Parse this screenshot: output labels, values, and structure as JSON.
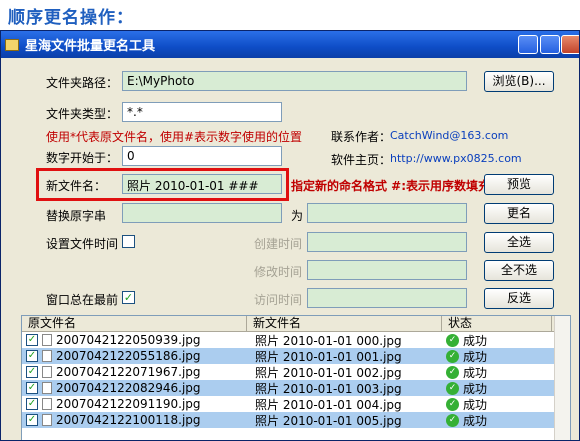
{
  "heading": "顺序更名操作：",
  "window": {
    "title": "星海文件批量更名工具"
  },
  "form": {
    "folder_path_label": "文件夹路径：",
    "folder_path_value": "E:\\MyPhoto",
    "browse_button": "浏览(B)...",
    "folder_type_label": "文件夹类型：",
    "folder_type_value": "*.*",
    "hint": "使用*代表原文件名，使用#表示数字使用的位置",
    "contact_label": "联系作者：",
    "contact_value": "CatchWind@163.com",
    "start_label": "数字开始于：",
    "start_value": "0",
    "homepage_label": "软件主页：",
    "homepage_value": "http://www.px0825.com",
    "newname_label": "新文件名：",
    "newname_value": "照片 2010-01-01 ###",
    "annotation": "指定新的命名格式 #:表示用序数填充",
    "preview_button": "预览",
    "replace_label": "替换原字串",
    "replace_for": "为",
    "rename_button": "更名",
    "settime_label": "设置文件时间",
    "create_label": "创建时间",
    "selectall_button": "全选",
    "modify_label": "修改时间",
    "deselect_button": "全不选",
    "ontop_label": "窗口总在最前",
    "access_label": "访问时间",
    "invert_button": "反选"
  },
  "table": {
    "headers": [
      "原文件名",
      "新文件名",
      "状态"
    ],
    "rows": [
      {
        "orig": "2007042122050939.jpg",
        "new": "照片 2010-01-01 000.jpg",
        "status": "成功"
      },
      {
        "orig": "2007042122055186.jpg",
        "new": "照片 2010-01-01 001.jpg",
        "status": "成功"
      },
      {
        "orig": "2007042122071967.jpg",
        "new": "照片 2010-01-01 002.jpg",
        "status": "成功"
      },
      {
        "orig": "2007042122082946.jpg",
        "new": "照片 2010-01-01 003.jpg",
        "status": "成功"
      },
      {
        "orig": "2007042122091190.jpg",
        "new": "照片 2010-01-01 004.jpg",
        "status": "成功"
      },
      {
        "orig": "2007042122100118.jpg",
        "new": "照片 2010-01-01 005.jpg",
        "status": "成功"
      }
    ]
  }
}
